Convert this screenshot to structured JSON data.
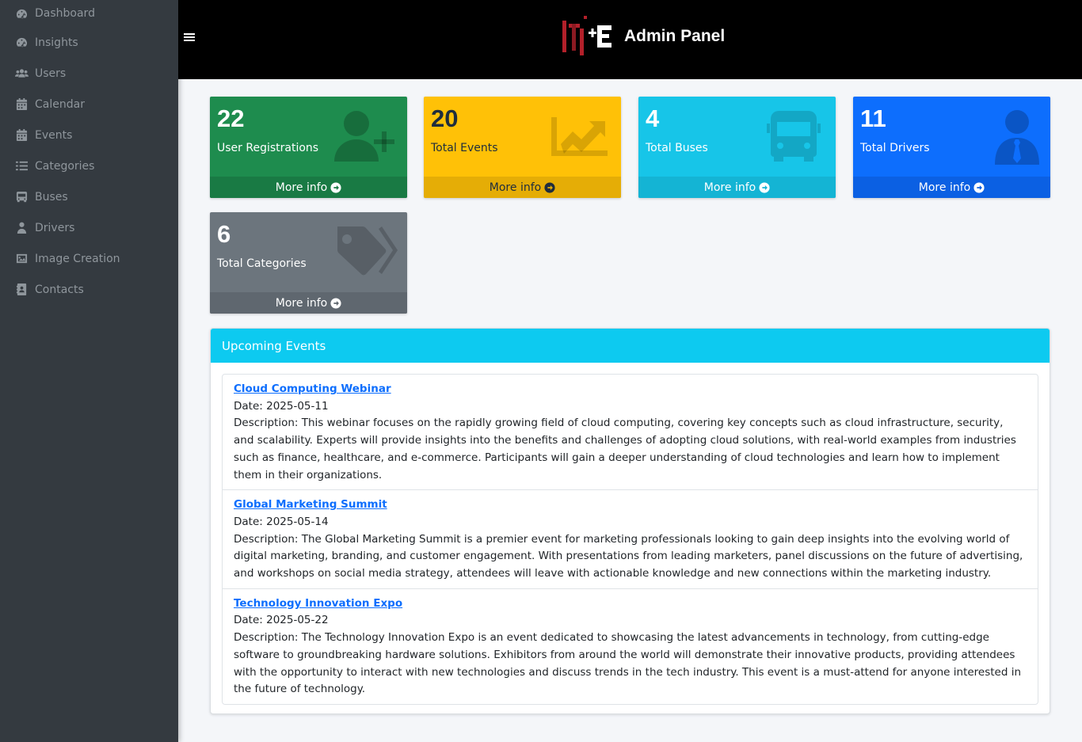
{
  "sidebar": {
    "items": [
      {
        "label": "Dashboard",
        "icon": "dashboard-icon"
      },
      {
        "label": "Insights",
        "icon": "insights-icon"
      },
      {
        "label": "Users",
        "icon": "users-icon"
      },
      {
        "label": "Calendar",
        "icon": "calendar-icon"
      },
      {
        "label": "Events",
        "icon": "calendar-icon"
      },
      {
        "label": "Categories",
        "icon": "list-icon"
      },
      {
        "label": "Buses",
        "icon": "bus-icon"
      },
      {
        "label": "Drivers",
        "icon": "driver-icon"
      },
      {
        "label": "Image Creation",
        "icon": "image-icon"
      },
      {
        "label": "Contacts",
        "icon": "contact-book-icon"
      }
    ]
  },
  "header": {
    "title": "Admin Panel",
    "logo_text": "ITI-E"
  },
  "stats": [
    {
      "value": "22",
      "label": "User Registrations",
      "link": "More info",
      "color": "#1e8c4e",
      "icon": "user-plus-icon"
    },
    {
      "value": "20",
      "label": "Total Events",
      "link": "More info",
      "color": "#ffc107",
      "icon": "chart-line-icon"
    },
    {
      "value": "4",
      "label": "Total Buses",
      "link": "More info",
      "color": "#17c5e8",
      "icon": "bus-icon"
    },
    {
      "value": "11",
      "label": "Total Drivers",
      "link": "More info",
      "color": "#0d6efd",
      "icon": "user-tie-icon"
    },
    {
      "value": "6",
      "label": "Total Categories",
      "link": "More info",
      "color": "#6c757d",
      "icon": "tags-icon"
    }
  ],
  "upcoming": {
    "title": "Upcoming Events",
    "events": [
      {
        "title": "Cloud Computing Webinar",
        "date": "Date: 2025-05-11",
        "description": "Description: This webinar focuses on the rapidly growing field of cloud computing, covering key concepts such as cloud infrastructure, security, and scalability. Experts will provide insights into the benefits and challenges of adopting cloud solutions, with real-world examples from industries such as finance, healthcare, and e-commerce. Participants will gain a deeper understanding of cloud technologies and learn how to implement them in their organizations."
      },
      {
        "title": "Global Marketing Summit",
        "date": "Date: 2025-05-14",
        "description": "Description: The Global Marketing Summit is a premier event for marketing professionals looking to gain deep insights into the evolving world of digital marketing, branding, and customer engagement. With presentations from leading marketers, panel discussions on the future of advertising, and workshops on social media strategy, attendees will leave with actionable knowledge and new connections within the marketing industry."
      },
      {
        "title": "Technology Innovation Expo",
        "date": "Date: 2025-05-22",
        "description": "Description: The Technology Innovation Expo is an event dedicated to showcasing the latest advancements in technology, from cutting-edge software to groundbreaking hardware solutions. Exhibitors from around the world will demonstrate their innovative products, providing attendees with the opportunity to interact with new technologies and discuss trends in the tech industry. This event is a must-attend for anyone interested in the future of technology."
      }
    ]
  }
}
